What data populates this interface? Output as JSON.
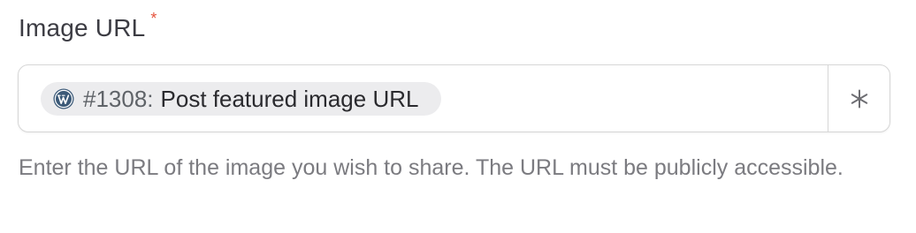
{
  "field": {
    "label": "Image URL",
    "required_marker": "*",
    "token": {
      "icon": "wordpress-icon",
      "id": "#1308:",
      "text": "Post featured image URL"
    },
    "addon_icon": "asterisk-icon",
    "help_text": "Enter the URL of the image you wish to share. The URL must be publicly accessible."
  },
  "colors": {
    "required": "#e5533d",
    "border": "#d6d6d6",
    "token_bg": "#ececee",
    "help_text": "#7b7b80",
    "wordpress_icon": "#3c5a78"
  }
}
